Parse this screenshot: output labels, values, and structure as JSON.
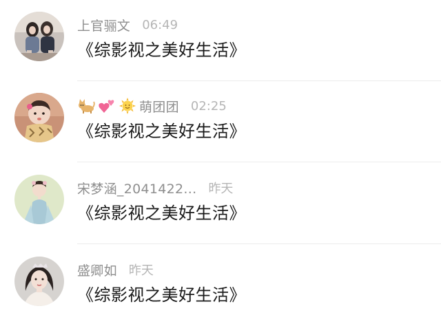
{
  "comments": [
    {
      "name": "上官骊文",
      "time": "06:49",
      "message": "《综影视之美好生活》"
    },
    {
      "name_prefix_icons": [
        "cat-icon",
        "two-hearts-icon",
        "sun-face-icon"
      ],
      "name": "萌团团",
      "time": "02:25",
      "message": "《综影视之美好生活》"
    },
    {
      "name": "宋梦涵_2041422...",
      "time": "昨天",
      "message": "《综影视之美好生活》"
    },
    {
      "name": "盛卿如",
      "time": "昨天",
      "message": "《综影视之美好生活》"
    }
  ],
  "colors": {
    "name": "#8e8e8e",
    "time": "#b5b5b5",
    "message": "#1a1a1a",
    "divider": "#ececec"
  }
}
